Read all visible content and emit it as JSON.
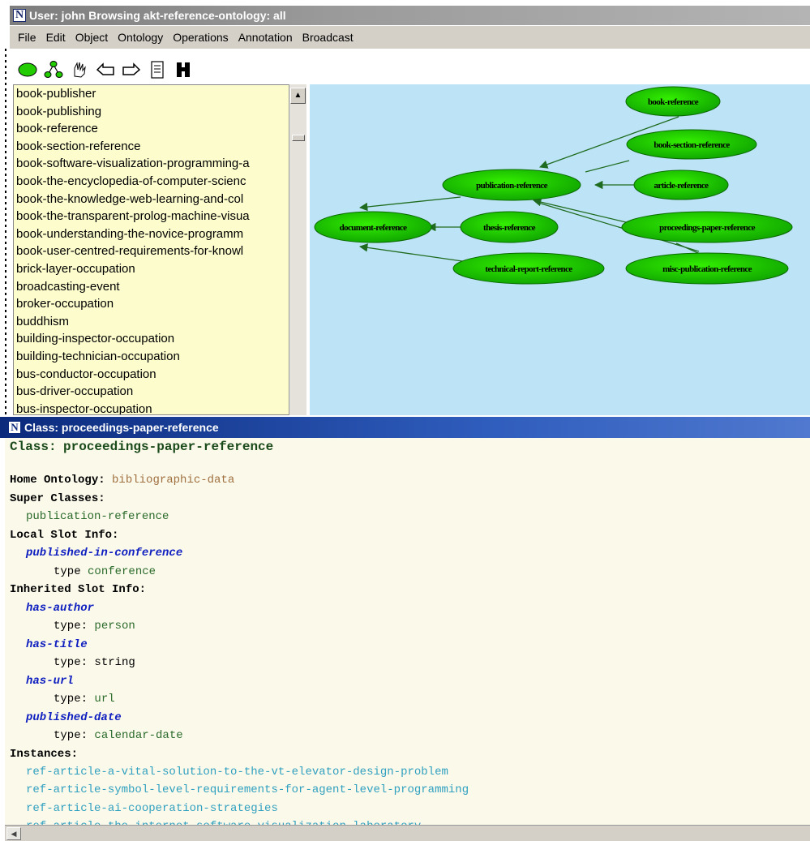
{
  "window": {
    "title": "User: john Browsing akt-reference-ontology: all",
    "icon_letter": "N"
  },
  "menu": [
    "File",
    "Edit",
    "Object",
    "Ontology",
    "Operations",
    "Annotation",
    "Broadcast"
  ],
  "toolbar": {
    "icons": [
      "ellipse-node-icon",
      "tree-graph-icon",
      "hand-pointer-icon",
      "arrow-left-icon",
      "arrow-right-icon",
      "document-icon",
      "h-icon"
    ]
  },
  "list": {
    "items": [
      "book-publisher",
      "book-publishing",
      "book-reference",
      "book-section-reference",
      "book-software-visualization-programming-a",
      "book-the-encyclopedia-of-computer-scienc",
      "book-the-knowledge-web-learning-and-col",
      "book-the-transparent-prolog-machine-visua",
      "book-understanding-the-novice-programm",
      "book-user-centred-requirements-for-knowl",
      "brick-layer-occupation",
      "broadcasting-event",
      "broker-occupation",
      "buddhism",
      "building-inspector-occupation",
      "building-technician-occupation",
      "bus-conductor-occupation",
      "bus-driver-occupation",
      "bus-inspector-occupation"
    ]
  },
  "graph": {
    "nodes": {
      "book_reference": "book-reference",
      "book_section_reference": "book-section-reference",
      "publication_reference": "publication-reference",
      "article_reference": "article-reference",
      "document_reference": "document-reference",
      "thesis_reference": "thesis-reference",
      "proceedings_paper_reference": "proceedings-paper-reference",
      "technical_report_reference": "technical-report-reference",
      "misc_publication_reference": "misc-publication-reference"
    },
    "colors": {
      "background": "#bde4f6",
      "node": "#22cc00",
      "edge": "#1f6b1f"
    }
  },
  "class_window": {
    "title": "Class: proceedings-paper-reference",
    "icon_letter": "N",
    "heading_label": "Class:",
    "heading_value": "proceedings-paper-reference",
    "home_ontology_label": "Home Ontology:",
    "home_ontology_value": "bibliographic-data",
    "super_classes_label": "Super Classes:",
    "super_class": "publication-reference",
    "local_slot_label": "Local Slot Info:",
    "local_slot_name": "published-in-conference",
    "local_slot_type_label": "type",
    "local_slot_type_value": "conference",
    "inherited_slot_label": "Inherited Slot Info:",
    "inherited_slots": [
      {
        "name": "has-author",
        "type_label": "type:",
        "type_value": "person"
      },
      {
        "name": "has-title",
        "type_label": "type:",
        "type_value": "string"
      },
      {
        "name": "has-url",
        "type_label": "type:",
        "type_value": "url"
      },
      {
        "name": "published-date",
        "type_label": "type:",
        "type_value": "calendar-date"
      }
    ],
    "instances_label": "Instances:",
    "instances": [
      "ref-article-a-vital-solution-to-the-vt-elevator-design-problem",
      "ref-article-symbol-level-requirements-for-agent-level-programming",
      "ref-article-ai-cooperation-strategies",
      "ref-article-the-internet-software-visualization-laboratory"
    ]
  }
}
